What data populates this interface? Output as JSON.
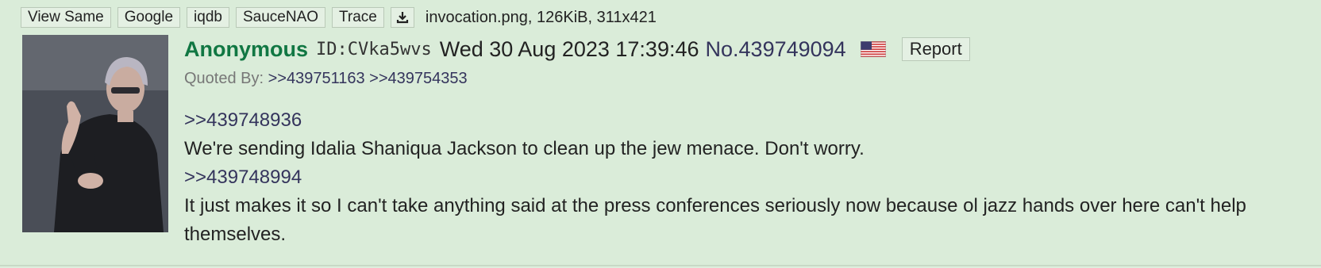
{
  "toolbar": {
    "buttons": [
      "View Same",
      "Google",
      "iqdb",
      "SauceNAO",
      "Trace"
    ],
    "download_icon": "download-icon",
    "file_info": "invocation.png, 126KiB, 311x421"
  },
  "post": {
    "name": "Anonymous",
    "poster_id": "ID:CVka5wvs",
    "date": "Wed 30 Aug 2023 17:39:46",
    "number": "No.439749094",
    "flag_icon": "us-flag-icon",
    "report_label": "Report",
    "quoted_by_label": "Quoted By:",
    "quoted_by": [
      ">>439751163",
      ">>439754353"
    ],
    "message": {
      "quote1": ">>439748936",
      "text1": "We're sending Idalia Shaniqua Jackson to clean up the jew menace. Don't worry.",
      "quote2": ">>439748994",
      "text2": "It just makes it so I can't take anything said at the press conferences seriously now because ol jazz hands over here can't help themselves."
    }
  },
  "colors": {
    "background": "#daecd9",
    "name": "#117743",
    "link": "#34345c"
  }
}
